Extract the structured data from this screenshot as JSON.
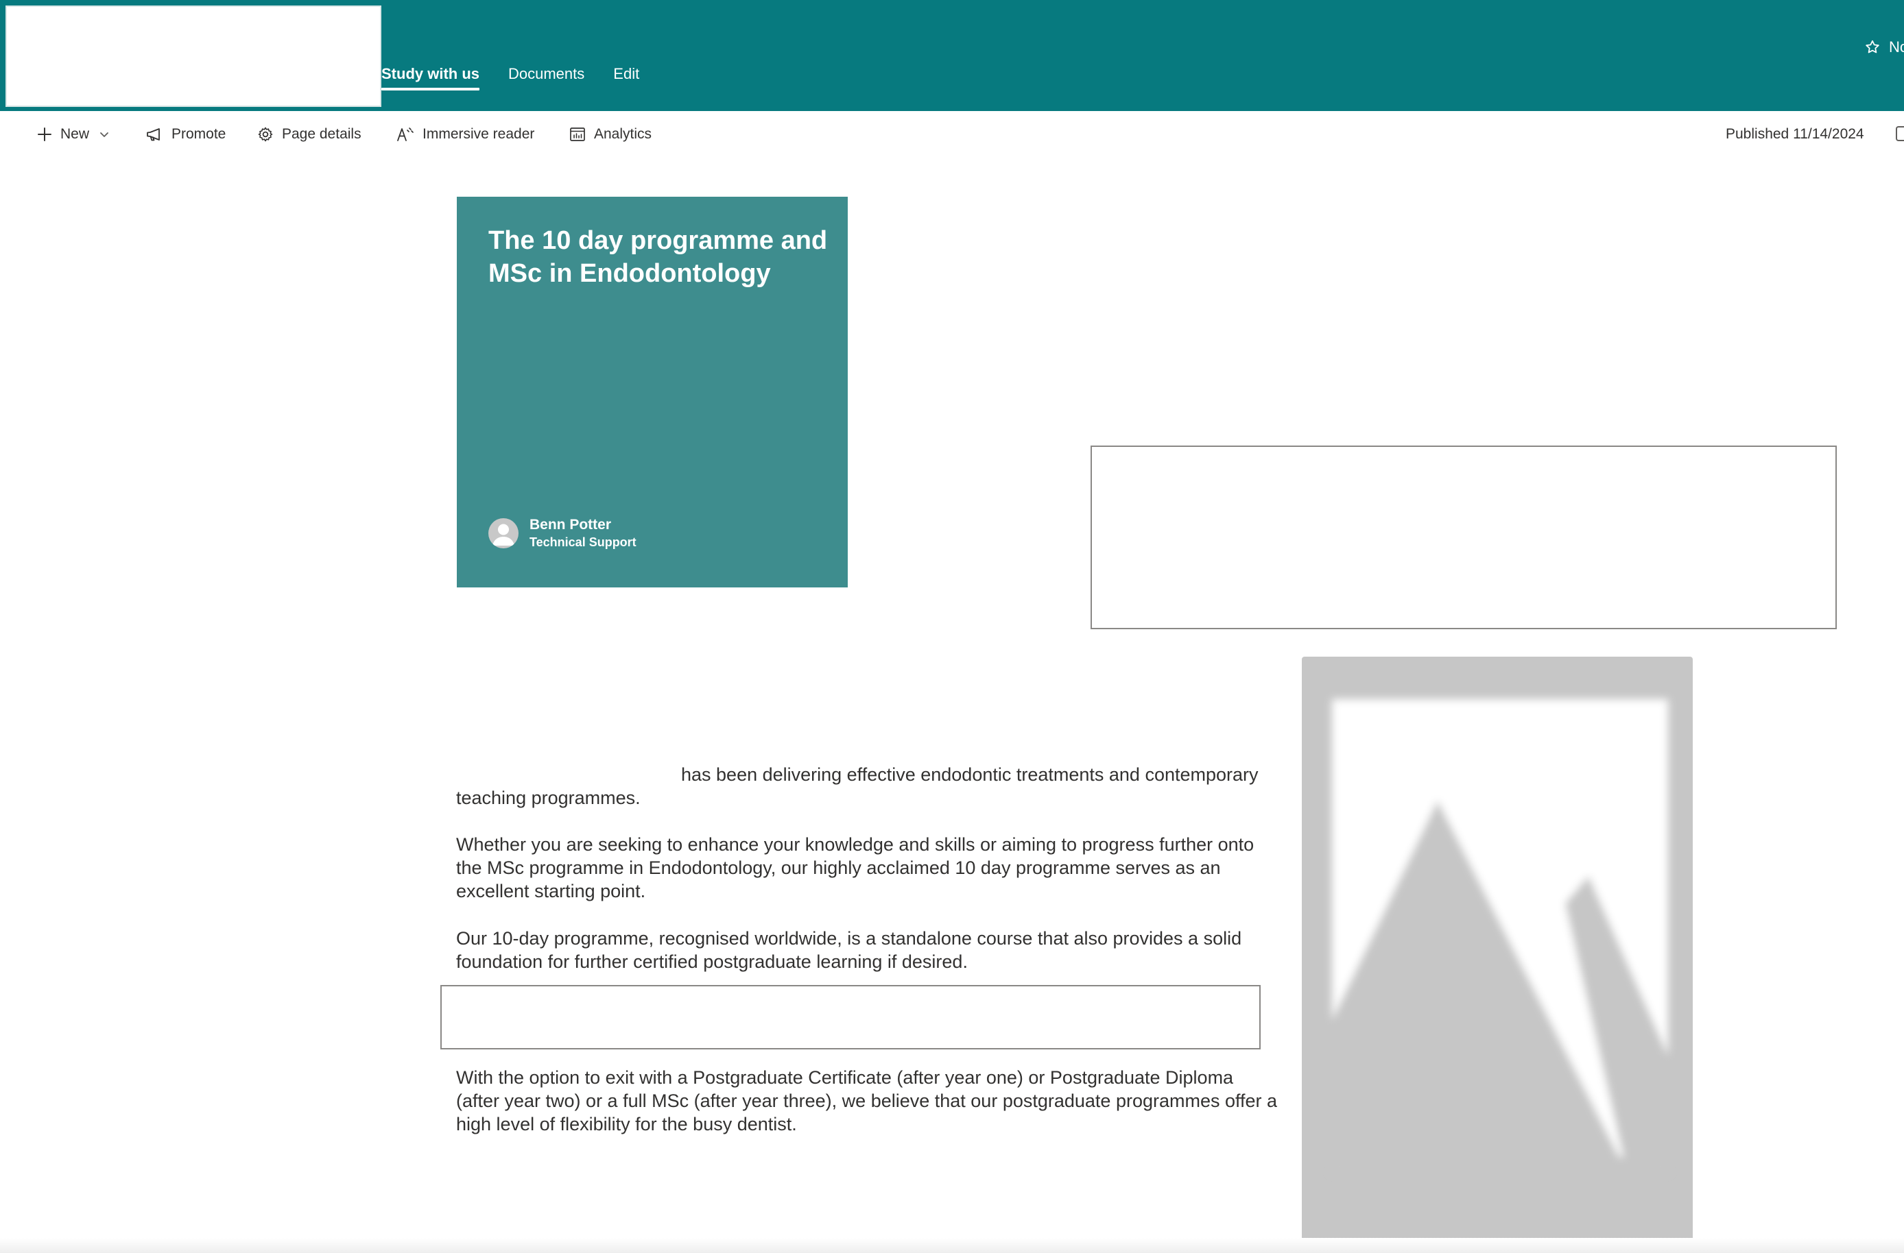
{
  "nav": {
    "items": [
      {
        "label": "Study with us",
        "active": true
      },
      {
        "label": "Documents",
        "active": false
      },
      {
        "label": "Edit",
        "active": false
      }
    ],
    "follow_label": "Nc"
  },
  "commands": {
    "new_label": "New",
    "promote_label": "Promote",
    "page_details_label": "Page details",
    "immersive_reader_label": "Immersive reader",
    "analytics_label": "Analytics",
    "published_label": "Published 11/14/2024"
  },
  "hero": {
    "title": "The 10 day programme and MSc in Endodontology",
    "author_name": "Benn Potter",
    "author_role": "Technical Support"
  },
  "content": {
    "paragraph1": "has been delivering effective endodontic treatments and contemporary teaching programmes.",
    "paragraph2": "Whether you are seeking to enhance your knowledge and skills or aiming to progress further onto the MSc programme in Endodontology, our highly acclaimed 10 day programme serves as an excellent starting point.",
    "paragraph3": "Our 10-day programme, recognised worldwide, is a standalone course that also provides a solid foundation for further certified postgraduate learning if desired.",
    "paragraph4": "With the option to exit with a Postgraduate Certificate (after year one) or Postgraduate Diploma (after year two) or a full MSc (after year three), we believe that our postgraduate programmes offer a high level of flexibility for the busy dentist."
  },
  "colors": {
    "suite_bar": "#077a7f",
    "hero_tile": "#3e8d8e",
    "text": "#323130",
    "image_placeholder": "#c6c6c6"
  },
  "icons": {
    "follow": "star-icon",
    "new": "plus-icon",
    "new_menu": "chevron-down-icon",
    "promote": "megaphone-icon",
    "page_details": "gear-icon",
    "immersive_reader": "immersive-reader-icon",
    "analytics": "analytics-icon",
    "avatar": "person-icon",
    "image": "image-placeholder-icon"
  }
}
